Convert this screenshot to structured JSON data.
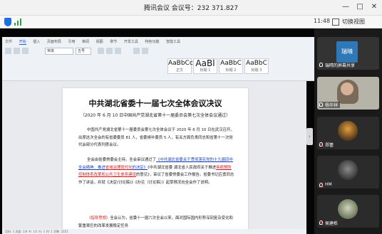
{
  "window": {
    "title": "腾讯会议  会议号：232 371.827",
    "controls": {
      "minimize": "—",
      "maximize": "□",
      "close": "✕"
    }
  },
  "statusbar": {
    "time": "11:48",
    "switch_view_label": "切换视图",
    "shield_icon": "shield-icon",
    "signal_icon": "signal-icon"
  },
  "wps": {
    "tabs": [
      "文件",
      "开始",
      "插入",
      "页面布局",
      "引用",
      "审阅",
      "视图",
      "章节",
      "开发工具",
      "特色功能",
      "智能工具"
    ],
    "active_tab": "开始",
    "font_name": "宋体",
    "font_size": "五号",
    "styles": [
      {
        "preview": "AaBbCcD",
        "name": "正文"
      },
      {
        "preview": "AaBl",
        "name": "标题 1"
      },
      {
        "preview": "AaBbC",
        "name": "标题 2"
      },
      {
        "preview": "AaBbC",
        "name": "标题 3"
      }
    ],
    "status_text": "页码: 1  页面: 1/4  节: 1/1  行: 1  列: 1  字数: 2221"
  },
  "document": {
    "title": "中共湖北省委十一届七次全体会议决议",
    "subtitle": "（2020 年 6 月 10 日中国共产党湖北省第十一届委员会第七次全体会议通过）",
    "para1": "中国共产党湖北省第十一届委员会第七次全体会议于 2020 年 6 月 10 日在武汉召开。出席这次全会的有省委委员 81 人，省委候补委员 5 人，有关方面负责同志和省第十一次党代会部分代表列席会议。",
    "para2_a": "全会由省委常委会主持。全会审议通过了",
    "para2_link1": "《中共湖北省委关于贯彻落实党的十九届四中全会精神、推进",
    "para2_red1": "省域治理现代化",
    "para2_b": "的决定》",
    "para2_c": "《中共湖北省委 湖北省人民政府关于推进",
    "para2_red2": "疾病预防控制体系改革和公共卫生体系建设",
    "para2_d": "的意见》，审议了省委常委会工作报告。省委书记应勇同志作了讲话，并就《决定(讨论稿)》《办见（讨论稿）》起草情况向全会作了说明。",
    "para3_a": "（",
    "para3_red": "指导思想",
    "para3_b": "）全会认为，省委十一届六次全会以来，面对国际国内形势深刻复杂变化和繁重艰巨的改革发展稳定任务"
  },
  "participants": [
    {
      "name": "瑞晴的屏幕共享",
      "avatar_text": "瑞晴",
      "mic": "on",
      "type": "avatar"
    },
    {
      "name": "杨华祥",
      "mic": "on",
      "type": "camera"
    },
    {
      "name": "郑蕾",
      "mic": "muted",
      "type": "image"
    },
    {
      "name": "HM",
      "mic": "muted",
      "type": "image"
    },
    {
      "name": "侯建栋",
      "mic": "muted",
      "type": "image"
    }
  ],
  "colors": {
    "accent_blue": "#1a3fb8",
    "highlight_red": "#d11a1a",
    "panel_bg": "#1a1a1a",
    "avatar_blue": "#2f78b8"
  }
}
